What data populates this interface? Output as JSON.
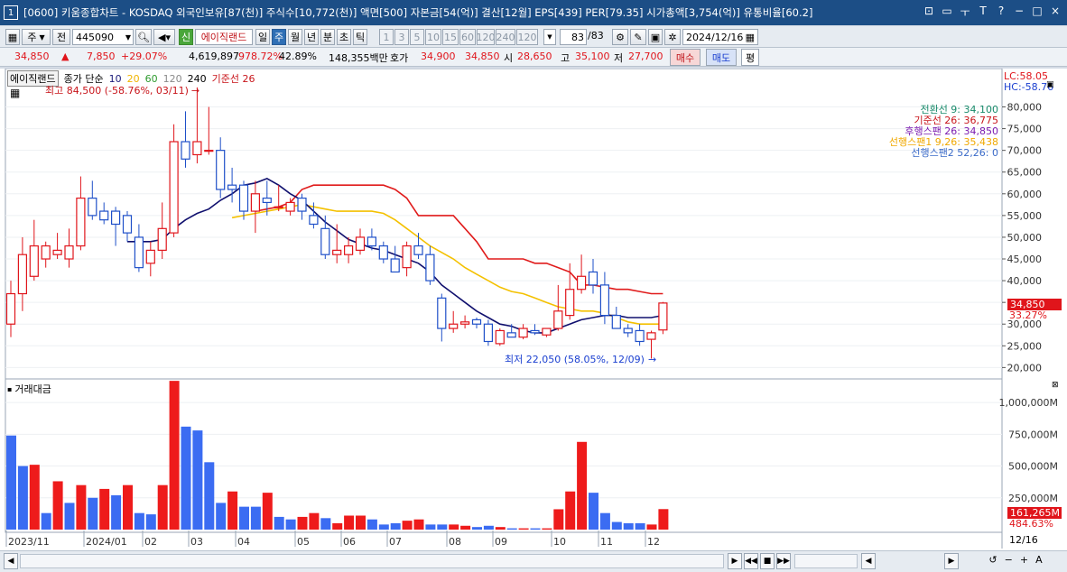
{
  "window": {
    "number": "1",
    "title": "[0600] 키움종합차트 - KOSDAQ 외국인보유[87(천)] 주식수[10,772(천)] 액면[500] 자본금[54(억)] 결산[12월] EPS[439] PER[79.35] 시가총액[3,754(억)] 유통비율[60.2]",
    "buttons": [
      "⊡",
      "▭",
      "ㅜ",
      "T",
      "?",
      "−",
      "□",
      "×"
    ]
  },
  "toolbar": {
    "period_dropdown": "주",
    "mode_btn": "전",
    "stock_code": "445090",
    "new_label": "신",
    "stock_name": "에이직랜드",
    "period_tabs": [
      "일",
      "주",
      "월",
      "년",
      "분",
      "초",
      "틱"
    ],
    "active_period": "주",
    "intervals": [
      "1",
      "3",
      "5",
      "10",
      "15",
      "60",
      "120",
      "240",
      "120"
    ],
    "count": "83",
    "count_total": "/83",
    "date": "2024/12/16"
  },
  "quote": {
    "price": "34,850",
    "change_arrow": "▲",
    "change": "7,850",
    "change_pct": "+29.07%",
    "volume": "4,619,897",
    "turnover_pct": "978.72%",
    "ratio": "42.89%",
    "amount": "148,355백만",
    "ask_label": "호가",
    "ask": "34,900",
    "bid": "34,850",
    "open_label": "시",
    "open": "28,650",
    "high_label": "고",
    "high": "35,100",
    "low_label": "저",
    "low": "27,700",
    "buy_btn": "매수",
    "sell_btn": "매도",
    "eval_btn": "평"
  },
  "chart_header": {
    "name_tag": "에이직랜드",
    "ma_label": "종가 단순",
    "ma_periods": [
      "10",
      "20",
      "60",
      "120",
      "240"
    ],
    "ma_colors": [
      "#1a1a7a",
      "#f0b400",
      "#2e9b2e",
      "#8a8a8a",
      "#000000"
    ],
    "base_line": "기준선 26",
    "lc": "LC:58.05",
    "hc": "HC:-58.76"
  },
  "ichimoku_legend": [
    {
      "text": "전환선 9: 34,100",
      "color": "#188a6a"
    },
    {
      "text": "기준선 26: 36,775",
      "color": "#c8141a"
    },
    {
      "text": "후행스팬 26: 34,850",
      "color": "#7a1ab0"
    },
    {
      "text": "선행스팬1 9,26: 35,438",
      "color": "#f0a800"
    },
    {
      "text": "선행스팬2 52,26: 0",
      "color": "#3a6ac8"
    }
  ],
  "annotations": {
    "high": "최고 84,500 (-58.76%, 03/11)",
    "low": "최저 22,050 (58.05%, 12/09)",
    "price_tag": "34,850",
    "price_pct": "33.27%",
    "vol_tag": "161,265M",
    "vol_pct": "484.63%"
  },
  "volume_panel": {
    "title": "거래대금",
    "axis_labels": [
      "1,000,000M",
      "750,000M",
      "500,000M",
      "250,000M"
    ]
  },
  "x_axis": {
    "labels": [
      "2023/11",
      "2024/01",
      "02",
      "03",
      "04",
      "05",
      "06",
      "07",
      "08",
      "09",
      "10",
      "11",
      "12"
    ],
    "current": "12/16"
  },
  "chart_data": {
    "type": "candlestick",
    "y_ticks": [
      80000,
      75000,
      70000,
      65000,
      60000,
      55000,
      50000,
      45000,
      40000,
      35000,
      30000,
      25000,
      20000
    ],
    "ylim": [
      18000,
      88000
    ],
    "candles": [
      {
        "o": 30000,
        "h": 40000,
        "l": 27000,
        "c": 37000
      },
      {
        "o": 37000,
        "h": 50000,
        "l": 33000,
        "c": 46000
      },
      {
        "o": 41000,
        "h": 54000,
        "l": 40000,
        "c": 48000
      },
      {
        "o": 45000,
        "h": 49000,
        "l": 43000,
        "c": 48000
      },
      {
        "o": 46000,
        "h": 51000,
        "l": 45000,
        "c": 47000
      },
      {
        "o": 45000,
        "h": 52000,
        "l": 43000,
        "c": 48000
      },
      {
        "o": 48000,
        "h": 64000,
        "l": 47000,
        "c": 59000
      },
      {
        "o": 59000,
        "h": 63000,
        "l": 54000,
        "c": 55000
      },
      {
        "o": 56000,
        "h": 58000,
        "l": 53000,
        "c": 54000
      },
      {
        "o": 56000,
        "h": 57000,
        "l": 48000,
        "c": 53000
      },
      {
        "o": 55000,
        "h": 56000,
        "l": 49000,
        "c": 51000
      },
      {
        "o": 50000,
        "h": 53000,
        "l": 42000,
        "c": 43000
      },
      {
        "o": 44000,
        "h": 49000,
        "l": 41000,
        "c": 47000
      },
      {
        "o": 47000,
        "h": 58000,
        "l": 45000,
        "c": 52000
      },
      {
        "o": 51000,
        "h": 76000,
        "l": 50000,
        "c": 72000
      },
      {
        "o": 72000,
        "h": 79000,
        "l": 66000,
        "c": 68000
      },
      {
        "o": 69000,
        "h": 84500,
        "l": 67000,
        "c": 72000
      },
      {
        "o": 70000,
        "h": 80000,
        "l": 69000,
        "c": 70000
      },
      {
        "o": 70000,
        "h": 73000,
        "l": 59000,
        "c": 61000
      },
      {
        "o": 62000,
        "h": 66000,
        "l": 58000,
        "c": 61000
      },
      {
        "o": 62000,
        "h": 63000,
        "l": 54000,
        "c": 56000
      },
      {
        "o": 56000,
        "h": 63000,
        "l": 51000,
        "c": 60000
      },
      {
        "o": 59000,
        "h": 63000,
        "l": 55000,
        "c": 58000
      },
      {
        "o": 57000,
        "h": 62000,
        "l": 56000,
        "c": 57000
      },
      {
        "o": 56000,
        "h": 59000,
        "l": 55000,
        "c": 58000
      },
      {
        "o": 59000,
        "h": 60000,
        "l": 54000,
        "c": 56000
      },
      {
        "o": 55000,
        "h": 58000,
        "l": 52000,
        "c": 53000
      },
      {
        "o": 52000,
        "h": 55000,
        "l": 45000,
        "c": 46000
      },
      {
        "o": 46000,
        "h": 53000,
        "l": 44000,
        "c": 47000
      },
      {
        "o": 46000,
        "h": 50000,
        "l": 44000,
        "c": 48000
      },
      {
        "o": 47000,
        "h": 52000,
        "l": 46000,
        "c": 50000
      },
      {
        "o": 50000,
        "h": 52000,
        "l": 47000,
        "c": 48000
      },
      {
        "o": 48000,
        "h": 49000,
        "l": 44000,
        "c": 45000
      },
      {
        "o": 45000,
        "h": 48000,
        "l": 42000,
        "c": 42000
      },
      {
        "o": 43000,
        "h": 49000,
        "l": 41000,
        "c": 48000
      },
      {
        "o": 48000,
        "h": 51000,
        "l": 45000,
        "c": 46000
      },
      {
        "o": 46000,
        "h": 48000,
        "l": 39000,
        "c": 40000
      },
      {
        "o": 36000,
        "h": 37000,
        "l": 26000,
        "c": 29000
      },
      {
        "o": 29000,
        "h": 33000,
        "l": 28000,
        "c": 30000
      },
      {
        "o": 30000,
        "h": 32000,
        "l": 29000,
        "c": 30500
      },
      {
        "o": 31000,
        "h": 31500,
        "l": 29000,
        "c": 30000
      },
      {
        "o": 30000,
        "h": 31000,
        "l": 25000,
        "c": 26000
      },
      {
        "o": 25500,
        "h": 29000,
        "l": 25000,
        "c": 28500
      },
      {
        "o": 28000,
        "h": 30000,
        "l": 27000,
        "c": 27000
      },
      {
        "o": 27000,
        "h": 30000,
        "l": 26500,
        "c": 29000
      },
      {
        "o": 28500,
        "h": 30000,
        "l": 27500,
        "c": 28000
      },
      {
        "o": 27500,
        "h": 29000,
        "l": 27000,
        "c": 29000
      },
      {
        "o": 29000,
        "h": 39000,
        "l": 28500,
        "c": 33000
      },
      {
        "o": 32000,
        "h": 44000,
        "l": 31000,
        "c": 38000
      },
      {
        "o": 38000,
        "h": 46000,
        "l": 37000,
        "c": 41000
      },
      {
        "o": 42000,
        "h": 45000,
        "l": 37000,
        "c": 39000
      },
      {
        "o": 39000,
        "h": 42000,
        "l": 30000,
        "c": 32000
      },
      {
        "o": 32000,
        "h": 34000,
        "l": 29000,
        "c": 29000
      },
      {
        "o": 29000,
        "h": 30000,
        "l": 27000,
        "c": 28000
      },
      {
        "o": 28500,
        "h": 30000,
        "l": 25000,
        "c": 26000
      },
      {
        "o": 26500,
        "h": 28500,
        "l": 22050,
        "c": 28000
      },
      {
        "o": 28650,
        "h": 35100,
        "l": 27700,
        "c": 34850
      }
    ],
    "tenkan": [
      [
        10,
        49000
      ],
      [
        12,
        49000
      ],
      [
        13,
        49500
      ],
      [
        14,
        52000
      ],
      [
        15,
        54000
      ],
      [
        16,
        55500
      ],
      [
        17,
        56500
      ],
      [
        18,
        58500
      ],
      [
        19,
        60000
      ],
      [
        20,
        62000
      ],
      [
        21,
        62500
      ],
      [
        22,
        63500
      ],
      [
        23,
        62000
      ],
      [
        24,
        60000
      ],
      [
        25,
        58500
      ],
      [
        26,
        56000
      ],
      [
        27,
        53500
      ],
      [
        28,
        51500
      ],
      [
        29,
        49500
      ],
      [
        30,
        48500
      ],
      [
        31,
        47500
      ],
      [
        32,
        47000
      ],
      [
        33,
        46000
      ],
      [
        34,
        45000
      ],
      [
        35,
        44000
      ],
      [
        36,
        42000
      ],
      [
        37,
        39000
      ],
      [
        38,
        37000
      ],
      [
        39,
        35000
      ],
      [
        40,
        33000
      ],
      [
        41,
        31500
      ],
      [
        42,
        30000
      ],
      [
        43,
        29500
      ],
      [
        44,
        28500
      ],
      [
        45,
        28000
      ],
      [
        46,
        28000
      ],
      [
        47,
        29000
      ],
      [
        48,
        30000
      ],
      [
        49,
        31000
      ],
      [
        50,
        31500
      ],
      [
        51,
        32000
      ],
      [
        52,
        32000
      ],
      [
        53,
        31500
      ],
      [
        54,
        31500
      ],
      [
        55,
        31500
      ],
      [
        56,
        32000
      ]
    ],
    "kijun": [
      [
        21,
        56000
      ],
      [
        22,
        56500
      ],
      [
        23,
        57000
      ],
      [
        24,
        58000
      ],
      [
        25,
        61000
      ],
      [
        26,
        62000
      ],
      [
        27,
        62000
      ],
      [
        28,
        62000
      ],
      [
        29,
        62000
      ],
      [
        30,
        62000
      ],
      [
        31,
        62000
      ],
      [
        32,
        62000
      ],
      [
        33,
        61000
      ],
      [
        34,
        59000
      ],
      [
        35,
        55000
      ],
      [
        36,
        55000
      ],
      [
        37,
        55000
      ],
      [
        38,
        55000
      ],
      [
        39,
        52000
      ],
      [
        40,
        49000
      ],
      [
        41,
        45000
      ],
      [
        42,
        45000
      ],
      [
        43,
        45000
      ],
      [
        44,
        45000
      ],
      [
        45,
        44000
      ],
      [
        46,
        44000
      ],
      [
        47,
        43000
      ],
      [
        48,
        42000
      ],
      [
        49,
        39000
      ],
      [
        50,
        39000
      ],
      [
        51,
        38500
      ],
      [
        52,
        38000
      ],
      [
        53,
        38000
      ],
      [
        54,
        37500
      ],
      [
        55,
        37000
      ],
      [
        56,
        37000
      ]
    ],
    "span1": [
      [
        19,
        54500
      ],
      [
        20,
        55000
      ],
      [
        21,
        55500
      ],
      [
        22,
        56000
      ],
      [
        23,
        56500
      ],
      [
        24,
        57000
      ],
      [
        25,
        57500
      ],
      [
        26,
        57000
      ],
      [
        27,
        56500
      ],
      [
        28,
        56000
      ],
      [
        29,
        56000
      ],
      [
        30,
        56000
      ],
      [
        31,
        56000
      ],
      [
        32,
        55500
      ],
      [
        33,
        54000
      ],
      [
        34,
        52000
      ],
      [
        35,
        50000
      ],
      [
        36,
        48000
      ],
      [
        37,
        46500
      ],
      [
        38,
        45000
      ],
      [
        39,
        43000
      ],
      [
        40,
        41500
      ],
      [
        41,
        40000
      ],
      [
        42,
        38500
      ],
      [
        43,
        37500
      ],
      [
        44,
        37000
      ],
      [
        45,
        36000
      ],
      [
        46,
        35000
      ],
      [
        47,
        34000
      ],
      [
        48,
        33500
      ],
      [
        49,
        33000
      ],
      [
        50,
        33000
      ],
      [
        51,
        32500
      ],
      [
        52,
        31500
      ],
      [
        53,
        30500
      ],
      [
        54,
        30000
      ],
      [
        55,
        30000
      ],
      [
        56,
        30000
      ]
    ],
    "volume": [
      {
        "v": 740000,
        "up": false
      },
      {
        "v": 500000,
        "up": false
      },
      {
        "v": 510000,
        "up": true
      },
      {
        "v": 130000,
        "up": false
      },
      {
        "v": 380000,
        "up": true
      },
      {
        "v": 210000,
        "up": false
      },
      {
        "v": 350000,
        "up": true
      },
      {
        "v": 250000,
        "up": false
      },
      {
        "v": 320000,
        "up": true
      },
      {
        "v": 270000,
        "up": false
      },
      {
        "v": 350000,
        "up": true
      },
      {
        "v": 130000,
        "up": false
      },
      {
        "v": 120000,
        "up": false
      },
      {
        "v": 350000,
        "up": true
      },
      {
        "v": 1170000,
        "up": true
      },
      {
        "v": 810000,
        "up": false
      },
      {
        "v": 780000,
        "up": false
      },
      {
        "v": 530000,
        "up": false
      },
      {
        "v": 210000,
        "up": false
      },
      {
        "v": 300000,
        "up": true
      },
      {
        "v": 180000,
        "up": false
      },
      {
        "v": 180000,
        "up": false
      },
      {
        "v": 290000,
        "up": true
      },
      {
        "v": 100000,
        "up": false
      },
      {
        "v": 80000,
        "up": false
      },
      {
        "v": 100000,
        "up": true
      },
      {
        "v": 130000,
        "up": true
      },
      {
        "v": 90000,
        "up": false
      },
      {
        "v": 50000,
        "up": true
      },
      {
        "v": 110000,
        "up": true
      },
      {
        "v": 110000,
        "up": true
      },
      {
        "v": 80000,
        "up": false
      },
      {
        "v": 40000,
        "up": false
      },
      {
        "v": 50000,
        "up": false
      },
      {
        "v": 70000,
        "up": true
      },
      {
        "v": 80000,
        "up": true
      },
      {
        "v": 40000,
        "up": false
      },
      {
        "v": 40000,
        "up": false
      },
      {
        "v": 40000,
        "up": true
      },
      {
        "v": 30000,
        "up": true
      },
      {
        "v": 20000,
        "up": false
      },
      {
        "v": 30000,
        "up": false
      },
      {
        "v": 20000,
        "up": true
      },
      {
        "v": 10000,
        "up": false
      },
      {
        "v": 10000,
        "up": true
      },
      {
        "v": 10000,
        "up": false
      },
      {
        "v": 10000,
        "up": true
      },
      {
        "v": 160000,
        "up": true
      },
      {
        "v": 300000,
        "up": true
      },
      {
        "v": 690000,
        "up": true
      },
      {
        "v": 290000,
        "up": false
      },
      {
        "v": 130000,
        "up": false
      },
      {
        "v": 60000,
        "up": false
      },
      {
        "v": 50000,
        "up": false
      },
      {
        "v": 50000,
        "up": false
      },
      {
        "v": 40000,
        "up": true
      },
      {
        "v": 161265,
        "up": true
      }
    ],
    "volume_ylim": [
      0,
      1100000
    ]
  }
}
